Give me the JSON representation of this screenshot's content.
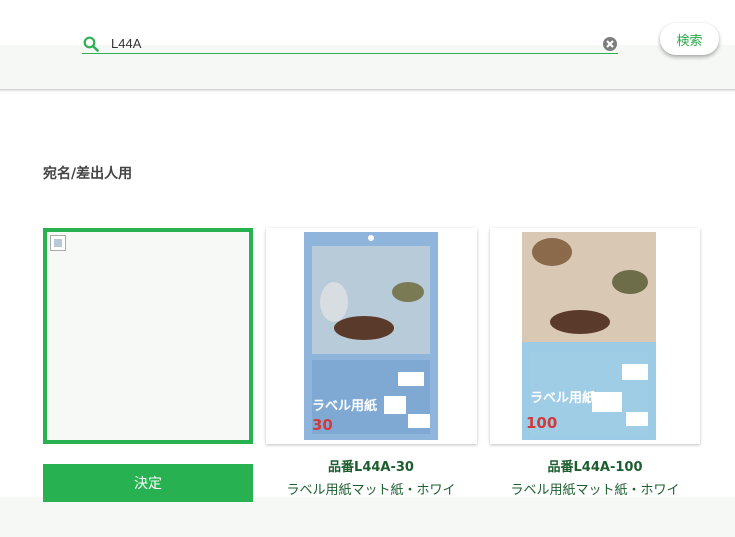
{
  "search": {
    "value": "L44A",
    "placeholder": "",
    "button_label": "検索"
  },
  "section": {
    "title": "宛名/差出人用"
  },
  "products": [
    {
      "code": "品番L44A-30",
      "name": "ラベル用紙マット紙・ホワイト",
      "package_label": "ラベル用紙",
      "sheet_count": "30",
      "package_color": "#8fb5dc"
    },
    {
      "code": "品番L44A-100",
      "name": "ラベル用紙マット紙・ホワイト",
      "package_label": "ラベル用紙",
      "sheet_count": "100",
      "package_color": "#9ccbe5"
    }
  ],
  "actions": {
    "decide_label": "決定"
  },
  "colors": {
    "accent": "#27b150",
    "product_text": "#1d5e2e"
  }
}
